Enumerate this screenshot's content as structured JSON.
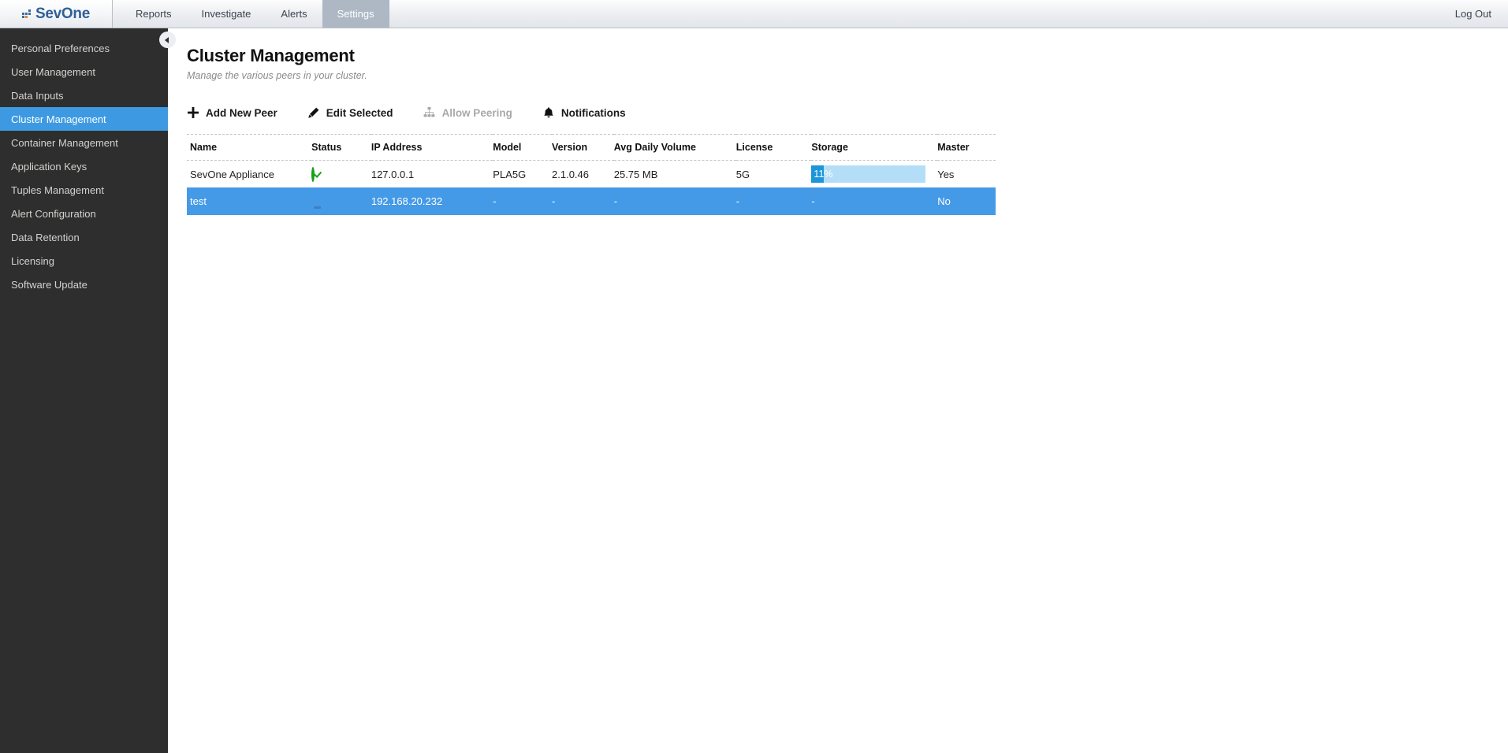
{
  "topbar": {
    "logo_text": "SevOne",
    "logo_icon": "sevone-logo-icon",
    "nav": [
      {
        "label": "Reports",
        "active": false
      },
      {
        "label": "Investigate",
        "active": false
      },
      {
        "label": "Alerts",
        "active": false
      },
      {
        "label": "Settings",
        "active": true
      }
    ],
    "logout_label": "Log Out"
  },
  "sidebar": {
    "items": [
      {
        "label": "Personal Preferences",
        "active": false
      },
      {
        "label": "User Management",
        "active": false
      },
      {
        "label": "Data Inputs",
        "active": false
      },
      {
        "label": "Cluster Management",
        "active": true
      },
      {
        "label": "Container Management",
        "active": false
      },
      {
        "label": "Application Keys",
        "active": false
      },
      {
        "label": "Tuples Management",
        "active": false
      },
      {
        "label": "Alert Configuration",
        "active": false
      },
      {
        "label": "Data Retention",
        "active": false
      },
      {
        "label": "Licensing",
        "active": false
      },
      {
        "label": "Software Update",
        "active": false
      }
    ],
    "collapse_icon": "chevron-left-icon"
  },
  "page": {
    "title": "Cluster Management",
    "subtitle": "Manage the various peers in your cluster."
  },
  "toolbar": {
    "add_new_peer": "Add New Peer",
    "edit_selected": "Edit Selected",
    "allow_peering": "Allow Peering",
    "notifications": "Notifications",
    "icons": {
      "add": "plus-icon",
      "edit": "pencil-icon",
      "peering": "network-hierarchy-icon",
      "notifications": "bell-icon"
    }
  },
  "table": {
    "columns": [
      "Name",
      "Status",
      "IP Address",
      "Model",
      "Version",
      "Avg Daily Volume",
      "License",
      "Storage",
      "Master"
    ],
    "rows": [
      {
        "name": "SevOne Appliance",
        "status_icon": "status-ok-icon",
        "ip": "127.0.0.1",
        "model": "PLA5G",
        "version": "2.1.0.46",
        "volume": "25.75 MB",
        "license": "5G",
        "storage_label": "11%",
        "storage_percent": 11,
        "master": "Yes",
        "selected": false
      },
      {
        "name": "test",
        "status_icon": "status-warning-icon",
        "ip": "192.168.20.232",
        "model": "-",
        "version": "-",
        "volume": "-",
        "license": "-",
        "storage_label": "-",
        "storage_percent": null,
        "master": "No",
        "selected": true
      }
    ]
  },
  "colors": {
    "accent_blue": "#3d9ae2",
    "selected_row": "#449ae6",
    "sidebar_bg": "#2e2e2e",
    "status_ok": "#18a018",
    "status_warning": "#f5c518",
    "storage_track": "#b4def7",
    "storage_fill": "#1b96d8",
    "logo_blue": "#2f5f98"
  }
}
